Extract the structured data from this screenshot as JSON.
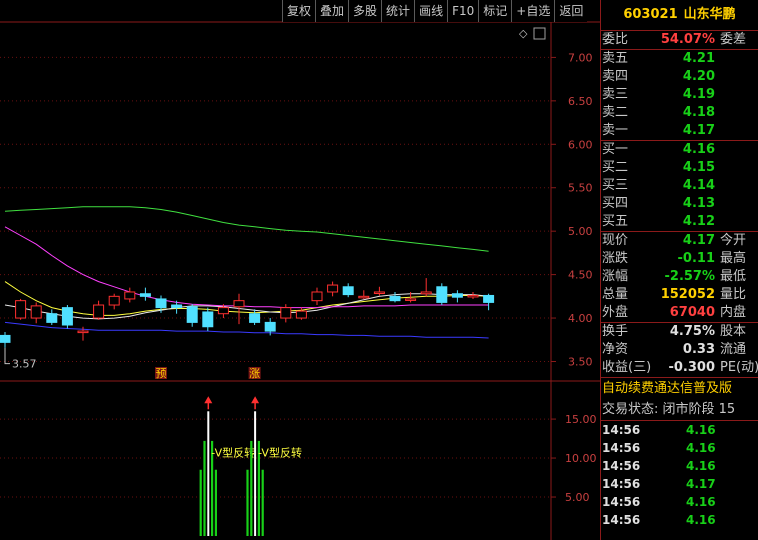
{
  "toolbar": [
    "复权",
    "叠加",
    "多股",
    "统计",
    "画线",
    "F10",
    "标记",
    "+自选",
    "返回"
  ],
  "stock": {
    "code": "603021",
    "name": "山东华鹏"
  },
  "chart_data": [
    {
      "type": "candlestick",
      "yticks": [
        3.5,
        4.0,
        4.5,
        5.0,
        5.5,
        6.0,
        6.5,
        7.0
      ],
      "ytick_labels": [
        "3.50",
        "4.00",
        "4.50",
        "5.00",
        "5.50",
        "6.00",
        "6.50",
        "7.00"
      ],
      "ylim": [
        3.31,
        7.35
      ],
      "low_label": "3.57",
      "badges": [
        {
          "text": "预",
          "index": 10
        },
        {
          "text": "涨",
          "index": 16
        }
      ],
      "candles": [
        [
          3.8,
          3.72,
          3.84,
          3.66
        ],
        [
          4.0,
          4.2,
          4.22,
          3.98
        ],
        [
          4.0,
          4.14,
          4.18,
          3.94
        ],
        [
          4.05,
          3.95,
          4.1,
          3.92
        ],
        [
          4.12,
          3.92,
          4.15,
          3.88
        ],
        [
          3.84,
          3.85,
          3.9,
          3.74
        ],
        [
          4.0,
          4.15,
          4.2,
          3.98
        ],
        [
          4.15,
          4.25,
          4.28,
          4.1
        ],
        [
          4.22,
          4.3,
          4.35,
          4.18
        ],
        [
          4.28,
          4.25,
          4.35,
          4.2
        ],
        [
          4.22,
          4.12,
          4.26,
          4.06
        ],
        [
          4.15,
          4.12,
          4.2,
          4.05
        ],
        [
          4.13,
          3.95,
          4.16,
          3.9
        ],
        [
          4.07,
          3.9,
          4.12,
          3.85
        ],
        [
          4.05,
          4.12,
          4.16,
          4.0
        ],
        [
          4.13,
          4.2,
          4.28,
          3.93
        ],
        [
          4.05,
          3.95,
          4.1,
          3.92
        ],
        [
          3.95,
          3.85,
          4.0,
          3.8
        ],
        [
          4.0,
          4.12,
          4.16,
          3.95
        ],
        [
          4.0,
          4.08,
          4.12,
          3.98
        ],
        [
          4.2,
          4.3,
          4.35,
          4.15
        ],
        [
          4.3,
          4.38,
          4.42,
          4.25
        ],
        [
          4.36,
          4.27,
          4.4,
          4.24
        ],
        [
          4.25,
          4.25,
          4.32,
          4.22
        ],
        [
          4.3,
          4.3,
          4.36,
          4.26
        ],
        [
          4.25,
          4.2,
          4.3,
          4.18
        ],
        [
          4.22,
          4.22,
          4.3,
          4.18
        ],
        [
          4.28,
          4.3,
          4.46,
          4.25
        ],
        [
          4.36,
          4.18,
          4.4,
          4.15
        ],
        [
          4.28,
          4.24,
          4.32,
          4.18
        ],
        [
          4.26,
          4.26,
          4.3,
          4.22
        ],
        [
          4.26,
          4.18,
          4.28,
          4.09
        ]
      ],
      "ma": [
        {
          "color": "#ffff40",
          "values": [
            4.42,
            4.3,
            4.2,
            4.12,
            4.08,
            4.05,
            4.03,
            4.03,
            4.05,
            4.08,
            4.1,
            4.11,
            4.11,
            4.1,
            4.08,
            4.07,
            4.06,
            4.07,
            4.08,
            4.09,
            4.12,
            4.15,
            4.17,
            4.19,
            4.21,
            4.23,
            4.24,
            4.25,
            4.25,
            4.26,
            4.26,
            4.25
          ]
        },
        {
          "color": "#e8e8e8",
          "values": [
            4.15,
            4.12,
            4.08,
            4.05,
            4.02,
            4.0,
            3.99,
            4.0,
            4.02,
            4.06,
            4.09,
            4.12,
            4.14,
            4.14,
            4.13,
            4.11,
            4.09,
            4.07,
            4.06,
            4.07,
            4.09,
            4.13,
            4.17,
            4.21,
            4.25,
            4.27,
            4.28,
            4.28,
            4.27,
            4.27,
            4.27,
            4.25
          ]
        },
        {
          "color": "#ff40ff",
          "values": [
            5.05,
            4.95,
            4.85,
            4.72,
            4.6,
            4.5,
            4.42,
            4.36,
            4.3,
            4.25,
            4.21,
            4.18,
            4.16,
            4.15,
            4.14,
            4.14,
            4.13,
            4.13,
            4.12,
            4.12,
            4.12,
            4.13,
            4.13,
            4.14,
            4.14,
            4.14,
            4.15,
            4.15,
            4.15,
            4.15,
            4.15,
            4.15
          ]
        },
        {
          "color": "#40e040",
          "values": [
            5.23,
            5.24,
            5.25,
            5.26,
            5.27,
            5.28,
            5.28,
            5.28,
            5.28,
            5.27,
            5.25,
            5.22,
            5.18,
            5.14,
            5.1,
            5.07,
            5.05,
            5.03,
            5.01,
            5.0,
            4.99,
            4.97,
            4.95,
            4.93,
            4.91,
            4.89,
            4.87,
            4.85,
            4.83,
            4.81,
            4.79,
            4.77
          ]
        },
        {
          "color": "#3a3aff",
          "values": [
            3.95,
            3.93,
            3.91,
            3.89,
            3.88,
            3.87,
            3.86,
            3.86,
            3.86,
            3.86,
            3.86,
            3.85,
            3.85,
            3.85,
            3.84,
            3.84,
            3.83,
            3.83,
            3.82,
            3.82,
            3.81,
            3.81,
            3.8,
            3.8,
            3.79,
            3.79,
            3.79,
            3.78,
            3.78,
            3.78,
            3.78,
            3.77
          ]
        }
      ]
    },
    {
      "type": "bar",
      "yticks": [
        5.0,
        10.0,
        15.0
      ],
      "ytick_labels": [
        "5.00",
        "10.00",
        "15.00"
      ],
      "ylim": [
        0,
        19.5
      ],
      "signals": [
        {
          "index": 13,
          "label": "V型反转",
          "bars": [
            [
              -4,
              8.5
            ],
            [
              -2,
              12.2
            ],
            [
              0,
              16.0
            ],
            [
              2,
              12.2
            ],
            [
              4,
              8.5
            ]
          ]
        },
        {
          "index": 16,
          "label": "V型反转",
          "bars": [
            [
              -4,
              8.5
            ],
            [
              -2,
              12.2
            ],
            [
              0,
              16.0
            ],
            [
              2,
              12.2
            ],
            [
              4,
              8.5
            ]
          ]
        }
      ]
    }
  ],
  "panel": {
    "weibi": {
      "label": "委比",
      "value": "54.07%",
      "extra": "委差"
    },
    "asks": [
      {
        "label": "卖五",
        "price": "4.21"
      },
      {
        "label": "卖四",
        "price": "4.20"
      },
      {
        "label": "卖三",
        "price": "4.19"
      },
      {
        "label": "卖二",
        "price": "4.18"
      },
      {
        "label": "卖一",
        "price": "4.17"
      }
    ],
    "bids": [
      {
        "label": "买一",
        "price": "4.16"
      },
      {
        "label": "买二",
        "price": "4.15"
      },
      {
        "label": "买三",
        "price": "4.14"
      },
      {
        "label": "买四",
        "price": "4.13"
      },
      {
        "label": "买五",
        "price": "4.12"
      }
    ],
    "stats": [
      {
        "label": "现价",
        "value": "4.17",
        "color": "green",
        "extra": "今开"
      },
      {
        "label": "涨跌",
        "value": "-0.11",
        "color": "green",
        "extra": "最高"
      },
      {
        "label": "涨幅",
        "value": "-2.57%",
        "color": "green",
        "extra": "最低"
      },
      {
        "label": "总量",
        "value": "152052",
        "color": "yellow",
        "extra": "量比"
      },
      {
        "label": "外盘",
        "value": "67040",
        "color": "red",
        "extra": "内盘"
      }
    ],
    "finance": [
      {
        "label": "换手",
        "value": "4.75%",
        "extra": "股本"
      },
      {
        "label": "净资",
        "value": "0.33",
        "extra": "流通"
      },
      {
        "label": "收益(三)",
        "value": "-0.300",
        "extra": "PE(动)"
      }
    ],
    "announcement": "自动续费通达信普及版",
    "trade_state": "交易状态: 闭市阶段 15",
    "trades": [
      {
        "time": "14:56",
        "price": "4.16"
      },
      {
        "time": "14:56",
        "price": "4.16"
      },
      {
        "time": "14:56",
        "price": "4.16"
      },
      {
        "time": "14:56",
        "price": "4.17"
      },
      {
        "time": "14:56",
        "price": "4.16"
      },
      {
        "time": "14:56",
        "price": "4.16"
      }
    ]
  }
}
